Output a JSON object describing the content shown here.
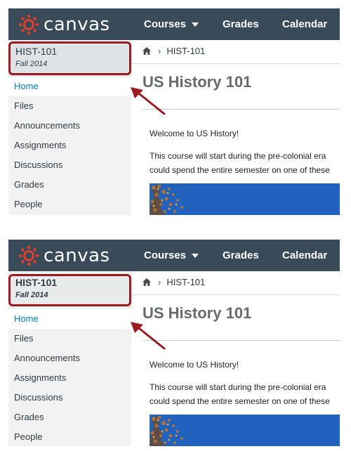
{
  "brand": {
    "name": "canvas",
    "color": "#e13f2b"
  },
  "topnav": {
    "courses": "Courses",
    "grades": "Grades",
    "calendar": "Calendar"
  },
  "course": {
    "code": "HIST-101",
    "term": "Fall 2014"
  },
  "sidebar": {
    "items": [
      {
        "label": "Home",
        "active": true
      },
      {
        "label": "Files"
      },
      {
        "label": "Announcements"
      },
      {
        "label": "Assignments"
      },
      {
        "label": "Discussions"
      },
      {
        "label": "Grades"
      },
      {
        "label": "People"
      }
    ]
  },
  "breadcrumb": {
    "home_icon": "home-icon",
    "current": "HIST-101"
  },
  "page": {
    "title": "US History 101",
    "welcome": "Welcome to US History!",
    "para_line1": "This course will start during the pre-colonial era",
    "para_line2": "could spend the entire semester on one of these"
  },
  "colors": {
    "topbar": "#394b58",
    "highlight": "#9b1c20",
    "link": "#0081bd"
  }
}
